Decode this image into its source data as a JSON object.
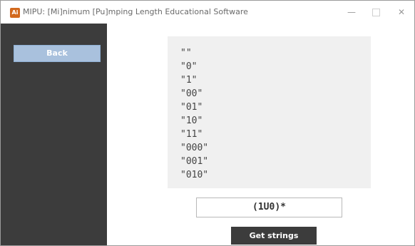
{
  "window": {
    "title": "MIPU: [Mi]nimum [Pu]mping Length Educational Software",
    "icon_label": "Ai",
    "icon_name": "app-icon",
    "accent_color": "#d2691e",
    "controls": {
      "minimize": "—",
      "close": "✕"
    }
  },
  "sidebar": {
    "back_label": "Back"
  },
  "strings": [
    "\"\"",
    "\"0\"",
    "\"1\"",
    "\"00\"",
    "\"01\"",
    "\"10\"",
    "\"11\"",
    "\"000\"",
    "\"001\"",
    "\"010\""
  ],
  "regex": {
    "value": "(1U0)*"
  },
  "actions": {
    "get_strings_label": "Get strings"
  }
}
